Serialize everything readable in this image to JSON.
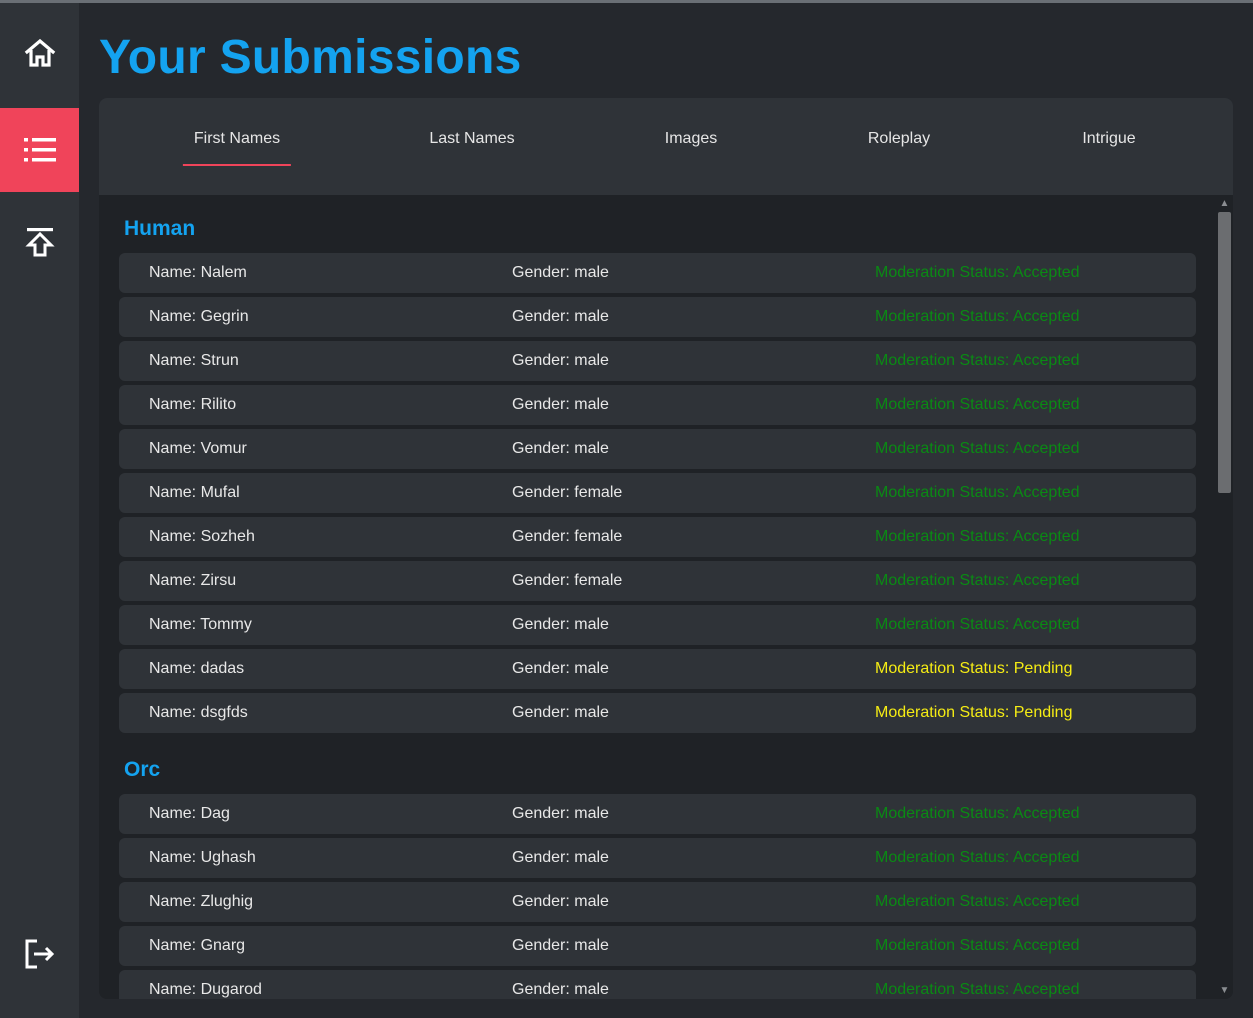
{
  "app": {
    "title": "Your Submissions"
  },
  "sidebar": {
    "items": [
      {
        "icon": "home-icon",
        "active": false
      },
      {
        "icon": "list-icon",
        "active": true
      },
      {
        "icon": "upload-icon",
        "active": false
      }
    ],
    "logout_icon": "logout-icon",
    "active_color": "#f0445a"
  },
  "tabs": [
    {
      "label": "First Names",
      "active": true
    },
    {
      "label": "Last Names",
      "active": false
    },
    {
      "label": "Images",
      "active": false
    },
    {
      "label": "Roleplay",
      "active": false
    },
    {
      "label": "Intrigue",
      "active": false
    }
  ],
  "colors": {
    "accent": "#14a3f0",
    "accepted": "#0a8a14",
    "pending": "#f5ec14"
  },
  "groups": [
    {
      "title": "Human",
      "rows": [
        {
          "name": "Name: Nalem",
          "gender": "Gender: male",
          "status": "Moderation Status: Accepted",
          "state": "accepted"
        },
        {
          "name": "Name: Gegrin",
          "gender": "Gender: male",
          "status": "Moderation Status: Accepted",
          "state": "accepted"
        },
        {
          "name": "Name: Strun",
          "gender": "Gender: male",
          "status": "Moderation Status: Accepted",
          "state": "accepted"
        },
        {
          "name": "Name: Rilito",
          "gender": "Gender: male",
          "status": "Moderation Status: Accepted",
          "state": "accepted"
        },
        {
          "name": "Name: Vomur",
          "gender": "Gender: male",
          "status": "Moderation Status: Accepted",
          "state": "accepted"
        },
        {
          "name": "Name: Mufal",
          "gender": "Gender: female",
          "status": "Moderation Status: Accepted",
          "state": "accepted"
        },
        {
          "name": "Name: Sozheh",
          "gender": "Gender: female",
          "status": "Moderation Status: Accepted",
          "state": "accepted"
        },
        {
          "name": "Name: Zirsu",
          "gender": "Gender: female",
          "status": "Moderation Status: Accepted",
          "state": "accepted"
        },
        {
          "name": "Name: Tommy",
          "gender": "Gender: male",
          "status": "Moderation Status: Accepted",
          "state": "accepted"
        },
        {
          "name": "Name: dadas",
          "gender": "Gender: male",
          "status": "Moderation Status: Pending",
          "state": "pending"
        },
        {
          "name": "Name: dsgfds",
          "gender": "Gender: male",
          "status": "Moderation Status: Pending",
          "state": "pending"
        }
      ]
    },
    {
      "title": "Orc",
      "rows": [
        {
          "name": "Name: Dag",
          "gender": "Gender: male",
          "status": "Moderation Status: Accepted",
          "state": "accepted"
        },
        {
          "name": "Name: Ughash",
          "gender": "Gender: male",
          "status": "Moderation Status: Accepted",
          "state": "accepted"
        },
        {
          "name": "Name: Zlughig",
          "gender": "Gender: male",
          "status": "Moderation Status: Accepted",
          "state": "accepted"
        },
        {
          "name": "Name: Gnarg",
          "gender": "Gender: male",
          "status": "Moderation Status: Accepted",
          "state": "accepted"
        },
        {
          "name": "Name: Dugarod",
          "gender": "Gender: male",
          "status": "Moderation Status: Accepted",
          "state": "accepted"
        }
      ]
    }
  ]
}
